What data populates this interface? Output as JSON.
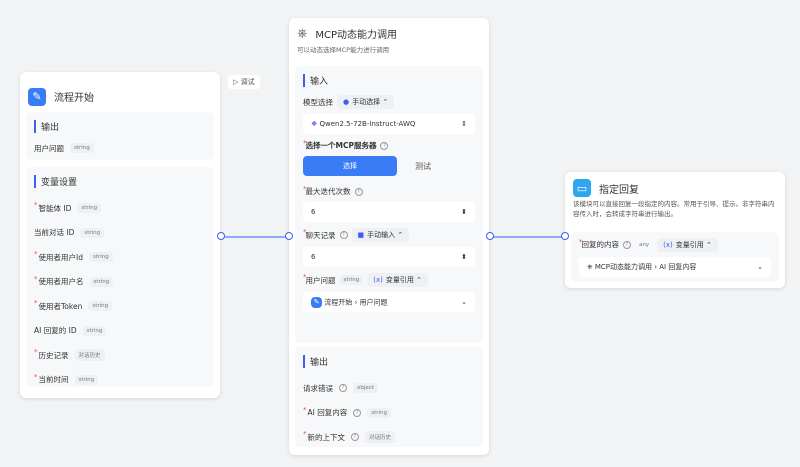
{
  "start": {
    "title": "流程开始",
    "debug": "调试",
    "output_title": "输出",
    "outputs": [
      {
        "name": "用户问题",
        "type": "string"
      }
    ],
    "vars_title": "变量设置",
    "vars": [
      {
        "name": "智能体 ID",
        "type": "string",
        "req": true
      },
      {
        "name": "当前对话 ID",
        "type": "string",
        "req": false
      },
      {
        "name": "使用者用户Id",
        "type": "string",
        "req": true
      },
      {
        "name": "使用者用户名",
        "type": "string",
        "req": true
      },
      {
        "name": "使用者Token",
        "type": "string",
        "req": true
      },
      {
        "name": "AI 回复的 ID",
        "type": "string",
        "req": false
      },
      {
        "name": "历史记录",
        "type": "对话历史",
        "req": true
      },
      {
        "name": "当前时间",
        "type": "string",
        "req": true
      }
    ]
  },
  "mcp": {
    "title": "MCP动态能力调用",
    "desc": "可以动态选择MCP能力进行调用",
    "input_title": "输入",
    "model_label": "模型选择",
    "model_mode": "手动选择",
    "model": "Qwen2.5-72B-Instruct-AWQ",
    "server_label": "选择一个MCP服务器",
    "select_btn": "选择",
    "test": "测试",
    "iter_label": "最大迭代次数",
    "iter_value": "6",
    "history_label": "聊天记录",
    "history_mode": "手动输入",
    "history_value": "6",
    "question_label": "用户问题",
    "question_type": "string",
    "question_mode": "变量引用",
    "question_ref_node": "流程开始",
    "question_ref_field": "用户问题",
    "output_title": "输出",
    "outputs": [
      {
        "name": "请求错误",
        "type": "object",
        "req": false
      },
      {
        "name": "AI 回复内容",
        "type": "string",
        "req": true
      },
      {
        "name": "新的上下文",
        "type": "对话历史",
        "req": true
      }
    ]
  },
  "reply": {
    "title": "指定回复",
    "desc": "该模块可以直接回复一段指定的内容。常用于引导、提示。非字符串内容传入时，会转成字符串进行输出。",
    "content_label": "回复的内容",
    "content_type": "any",
    "content_mode": "变量引用",
    "ref_node": "MCP动态能力调用",
    "ref_field": "AI 回复内容"
  }
}
